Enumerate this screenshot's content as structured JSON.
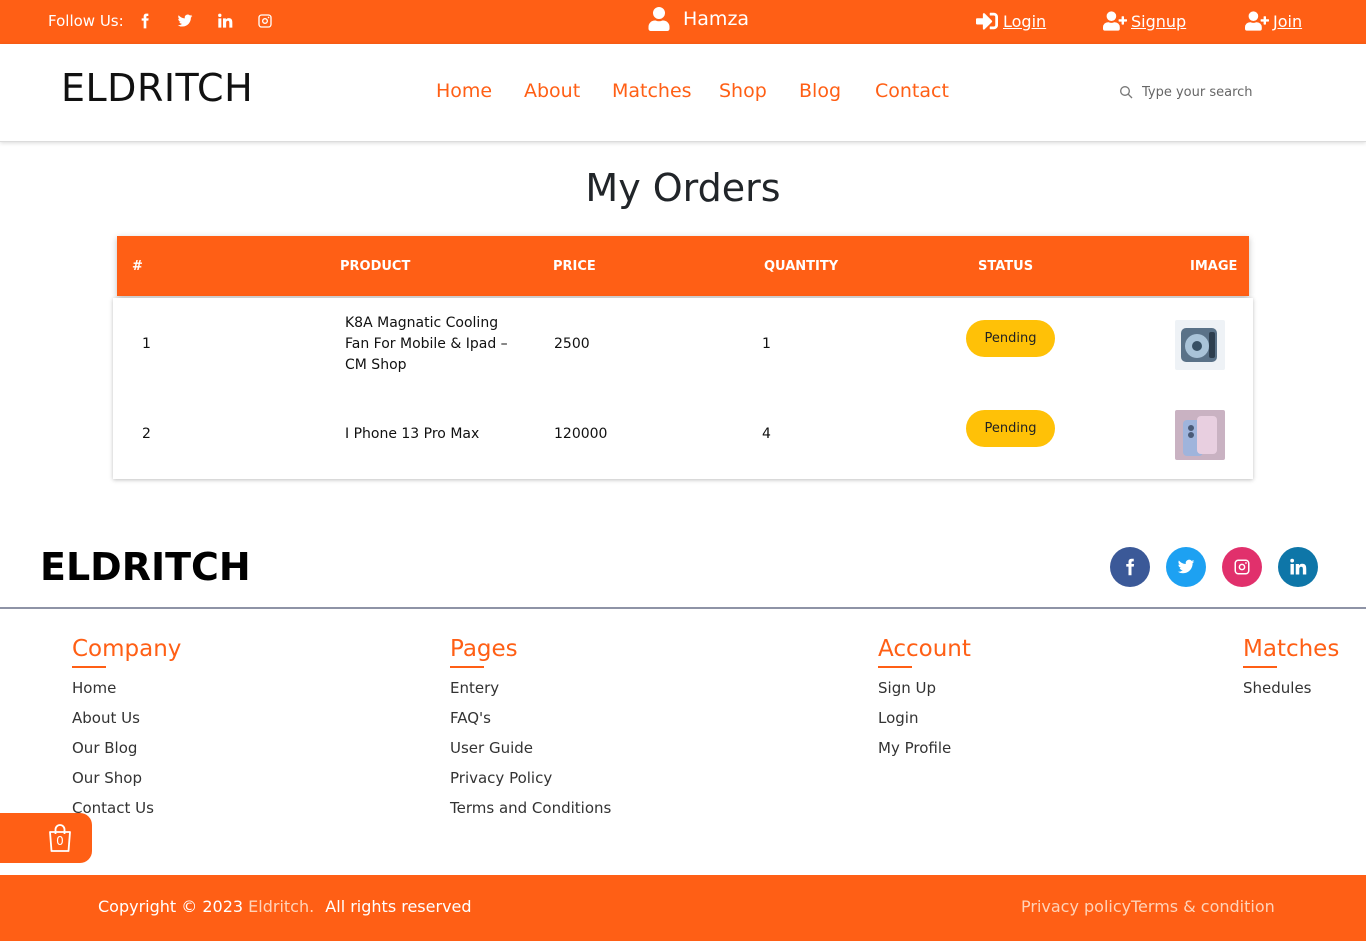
{
  "topbar": {
    "follow_label": "Follow Us:",
    "social": [
      "facebook-icon",
      "twitter-icon",
      "linkedin-icon",
      "instagram-icon"
    ],
    "username": "Hamza",
    "login": "Login",
    "signup": "Signup",
    "join": "Join"
  },
  "header": {
    "brand": "ELDRITCH",
    "nav": [
      "Home",
      "About",
      "Matches",
      "Shop",
      "Blog",
      "Contact"
    ],
    "search_placeholder": "Type your search"
  },
  "page": {
    "title": "My Orders"
  },
  "orders": {
    "columns": [
      "#",
      "PRODUCT",
      "PRICE",
      "QUANTITY",
      "STATUS",
      "IMAGE"
    ],
    "rows": [
      {
        "num": "1",
        "product": "K8A Magnatic Cooling Fan For Mobile & Ipad – CM Shop",
        "price": "2500",
        "quantity": "1",
        "status": "Pending"
      },
      {
        "num": "2",
        "product": "I Phone 13 Pro Max",
        "price": "120000",
        "quantity": "4",
        "status": "Pending"
      }
    ]
  },
  "footer": {
    "brand": "ELDRITCH",
    "social": [
      "facebook-icon",
      "twitter-icon",
      "instagram-icon",
      "linkedin-icon"
    ],
    "columns": [
      {
        "title": "Company",
        "links": [
          "Home",
          "About Us",
          "Our Blog",
          "Our Shop",
          "Contact Us"
        ]
      },
      {
        "title": "Pages",
        "links": [
          "Entery",
          "FAQ's",
          "User Guide",
          "Privacy Policy",
          "Terms and Conditions"
        ]
      },
      {
        "title": "Account",
        "links": [
          "Sign Up",
          "Login",
          "My Profile"
        ]
      },
      {
        "title": "Matches",
        "links": [
          "Shedules"
        ]
      }
    ],
    "cart_count": "0",
    "copyright_prefix": "Copyright © 2023",
    "copyright_brand": "Eldritch.",
    "copyright_suffix": "All rights reserved",
    "privacy": "Privacy policy",
    "terms": "Terms & condition"
  },
  "colors": {
    "accent": "#ff5f15",
    "badge": "#ffc107",
    "facebook": "#3b5998",
    "twitter": "#1da1f2",
    "instagram": "#e1306c",
    "linkedin": "#0e76a8"
  }
}
